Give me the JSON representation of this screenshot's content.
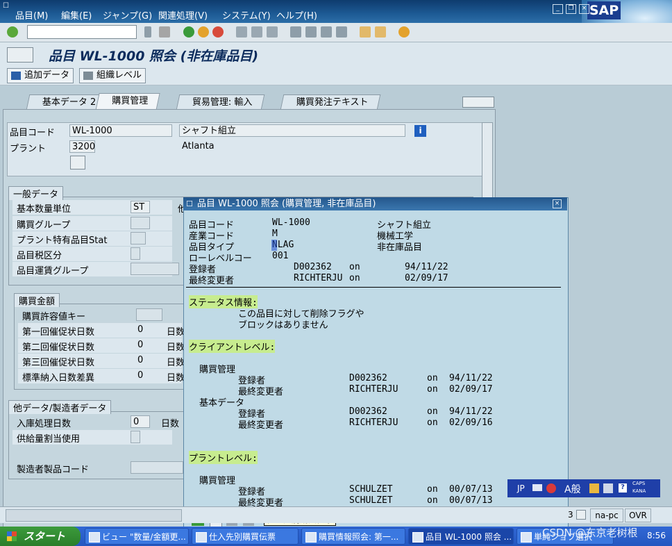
{
  "menubar": {
    "items": [
      "品目(M)",
      "編集(E)",
      "ジャンプ(G)",
      "関連処理(V)",
      "システム(Y)",
      "ヘルプ(H)"
    ],
    "logo": "SAP"
  },
  "toolbar": {
    "command_value": "",
    "icons": [
      "enter-icon",
      "back-icon",
      "save-icon",
      "green-arrow-icon",
      "exit-icon",
      "cancel-icon",
      "print-icon",
      "find-icon",
      "find-next-icon",
      "first-page-icon",
      "prev-page-icon",
      "next-page-icon",
      "last-page-icon",
      "new-session-icon",
      "shortcut-icon",
      "help-icon"
    ]
  },
  "title": "品目 WL-1000 照会 (非在庫品目)",
  "appbar": {
    "additional_data": "追加データ",
    "org_levels": "組織レベル"
  },
  "tabs": [
    "基本データ 2",
    "購買管理",
    "貿易管理: 輸入",
    "購買発注テキスト"
  ],
  "header": {
    "material_label": "品目コード",
    "material_value": "WL-1000",
    "material_desc": "シャフト組立",
    "plant_label": "プラント",
    "plant_value": "3200",
    "plant_name": "Atlanta"
  },
  "general": {
    "title": "一般データ",
    "rows": [
      {
        "label": "基本数量単位",
        "value": "ST"
      },
      {
        "label": "購買グループ",
        "value": ""
      },
      {
        "label": "プラント特有品目Stat",
        "value": ""
      },
      {
        "label": "品目税区分",
        "value": ""
      },
      {
        "label": "品目運賃グループ",
        "value": ""
      }
    ],
    "cut_label": "他"
  },
  "purchasing_values": {
    "title": "購買金額",
    "rows": [
      {
        "label": "購買許容値キー",
        "value": "",
        "unit": ""
      },
      {
        "label": "第一回催促状日数",
        "value": "0",
        "unit": "日数"
      },
      {
        "label": "第二回催促状日数",
        "value": "0",
        "unit": "日数"
      },
      {
        "label": "第三回催促状日数",
        "value": "0",
        "unit": "日数"
      },
      {
        "label": "標準納入日数差異",
        "value": "0",
        "unit": "日数"
      }
    ]
  },
  "other_data": {
    "title": "他データ/製造者データ",
    "rows": [
      {
        "label": "入庫処理日数",
        "value": "0",
        "unit": "日数"
      },
      {
        "label": "供給量割当使用",
        "value": ""
      },
      {
        "label": "製造者製品コード",
        "value": ""
      }
    ]
  },
  "popup": {
    "title": "品目 WL-1000 照会 (購買管理, 非在庫品目)",
    "lines": [
      {
        "label": "品目コード",
        "value": "WL-1000",
        "extra": "シャフト組立"
      },
      {
        "label": "産業コード",
        "value": "M",
        "extra": "機械工学"
      },
      {
        "label": "品目タイプ",
        "value": "NLAG",
        "extra": "非在庫品目"
      },
      {
        "label": "ローレベルコー",
        "value": "001",
        "extra": ""
      }
    ],
    "created": {
      "label": "登録者",
      "user": "D002362",
      "on": "on",
      "date": "94/11/22"
    },
    "changed": {
      "label": "最終変更者",
      "user": "RICHTERJU",
      "on": "on",
      "date": "02/09/17"
    },
    "status_heading": "ステータス情報:",
    "status_text1": "この品目に対して削除フラグや",
    "status_text2": "ブロックはありません",
    "client_heading": "クライアントレベル:",
    "client_sections": [
      {
        "name": "購買管理",
        "rows": [
          {
            "label": "登録者",
            "user": "D002362",
            "on": "on",
            "date": "94/11/22"
          },
          {
            "label": "最終変更者",
            "user": "RICHTERJU",
            "on": "on",
            "date": "02/09/17"
          }
        ]
      },
      {
        "name": "基本データ",
        "rows": [
          {
            "label": "登録者",
            "user": "D002362",
            "on": "on",
            "date": "94/11/22"
          },
          {
            "label": "最終変更者",
            "user": "RICHTERJU",
            "on": "on",
            "date": "02/09/16"
          }
        ]
      }
    ],
    "plant_heading": "プラントレベル:",
    "plant_sections": [
      {
        "name": "購買管理",
        "rows": [
          {
            "label": "登録者",
            "user": "SCHULZET",
            "on": "on",
            "date": "00/07/13"
          },
          {
            "label": "最終変更者",
            "user": "SCHULZET",
            "on": "on",
            "date": "00/07/13"
          }
        ]
      }
    ]
  },
  "tooltip": "仕入先別購買伝票",
  "status": {
    "session": "3",
    "server": "na-pc",
    "mode": "OVR"
  },
  "langbar": {
    "lang": "JP",
    "mode": "A般",
    "caps": "CAPS",
    "kana": "KANA"
  },
  "taskbar": {
    "start": "スタート",
    "items": [
      "ビュー \"数量/金額更...",
      "仕入先別購買伝票",
      "購買情報照会: 第一...",
      "品目 WL-1000 照会 ...",
      "単純ジョブ選択"
    ]
  },
  "watermark": "CSDN @东京老树根",
  "clock": "8:56"
}
